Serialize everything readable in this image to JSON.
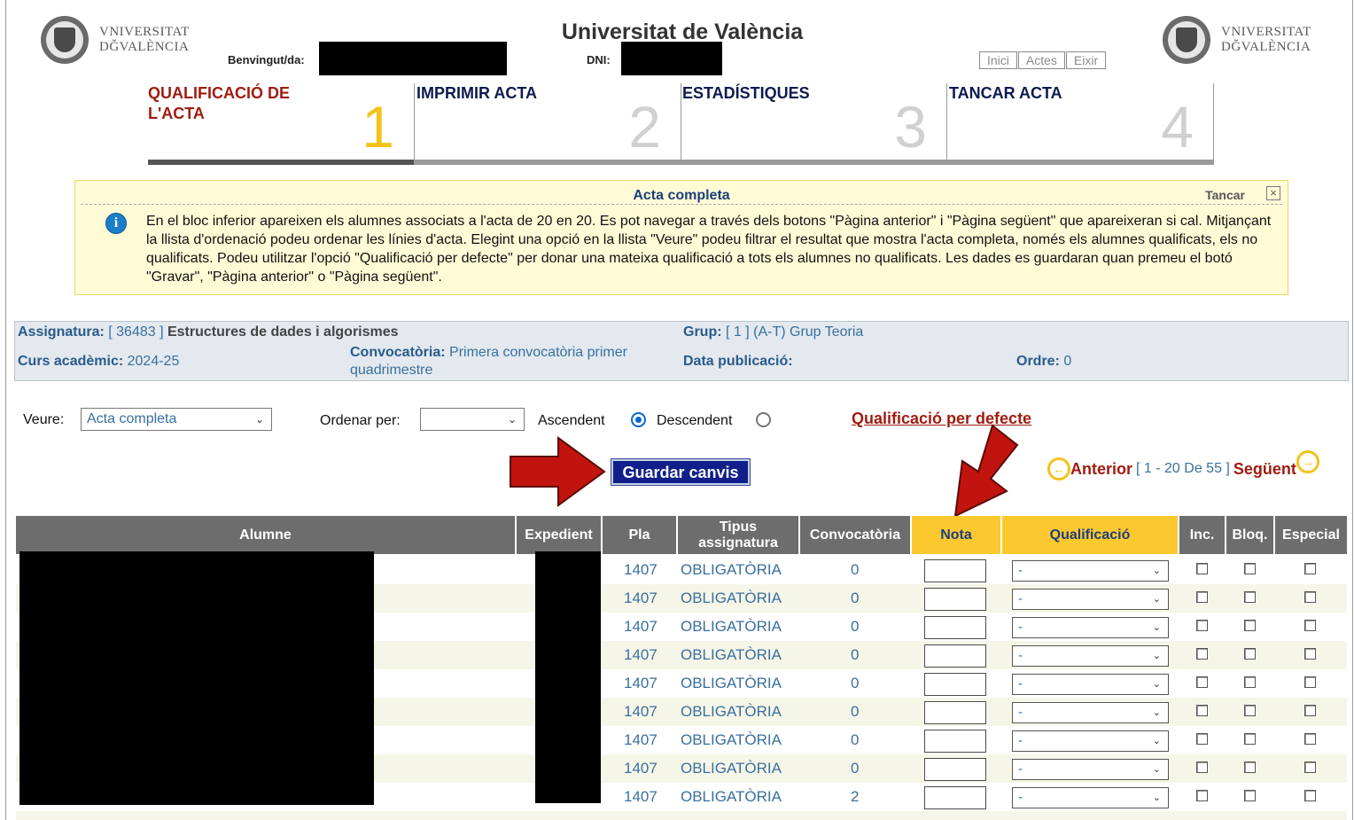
{
  "header": {
    "logo_line1": "VNIVERSITAT",
    "logo_line2": "DĞVALÈNCIA",
    "title": "Universitat de València",
    "welcome_label": "Benvingut/da:",
    "dni_label": "DNI:",
    "nav": [
      "Inici",
      "Actes",
      "Eixir"
    ]
  },
  "steps": [
    {
      "label": "QUALIFICACIÓ DE L'ACTA",
      "number": "1",
      "active": true
    },
    {
      "label": "IMPRIMIR ACTA",
      "number": "2",
      "active": false
    },
    {
      "label": "ESTADÍSTIQUES",
      "number": "3",
      "active": false
    },
    {
      "label": "TANCAR ACTA",
      "number": "4",
      "active": false
    }
  ],
  "info": {
    "title": "Acta completa",
    "close_label": "Tancar",
    "close_icon": "close-icon",
    "text": "En el bloc inferior apareixen els alumnes associats a l'acta de 20 en 20. Es pot navegar a través dels botons \"Pàgina anterior\" i \"Pàgina següent\" que apareixeran si cal. Mitjançant la llista d'ordenació podeu ordenar les línies d'acta. Elegint una opció en la llista \"Veure\" podeu filtrar el resultat que mostra l'acta completa, només els alumnes qualificats, els no qualificats. Podeu utilitzar l'opció \"Qualificació per defecte\" per donar una mateixa qualificació a tots els alumnes no qualificats. Les dades es guardaran quan premeu el botó \"Gravar\", \"Pàgina anterior\" o \"Pàgina següent\"."
  },
  "subject": {
    "assignatura_label": "Assignatura:",
    "assignatura_code": "[ 36483 ]",
    "assignatura_name": "Estructures de dades i algorismes",
    "grup_label": "Grup:",
    "grup_value": "[ 1 ] (A-T) Grup Teoria",
    "curs_label": "Curs acadèmic:",
    "curs_value": "2024-25",
    "convocatoria_label": "Convocatòria:",
    "convocatoria_value": "Primera convocatòria primer quadrimestre",
    "data_label": "Data publicació:",
    "data_value": "",
    "ordre_label": "Ordre:",
    "ordre_value": "0"
  },
  "controls": {
    "veure_label": "Veure:",
    "veure_value": "Acta completa",
    "ordenar_label": "Ordenar per:",
    "ordenar_value": "",
    "ascendent_label": "Ascendent",
    "descendent_label": "Descendent",
    "selected_order": "Ascendent",
    "default_grade_link": "Qualificació per defecte",
    "save_button": "Guardar canvis"
  },
  "pager": {
    "prev": "Anterior",
    "range": "[ 1 - 20 De 55 ]",
    "next": "Següent"
  },
  "table": {
    "headers": [
      "Alumne",
      "Expedient",
      "Pla",
      "Tipus assignatura",
      "Convocatòria",
      "Nota",
      "Qualificació",
      "Inc.",
      "Bloq.",
      "Especial"
    ],
    "rows": [
      {
        "pla": "1407",
        "tipus": "OBLIGATÒRIA",
        "convocatoria": "0",
        "qualificacio": "-"
      },
      {
        "pla": "1407",
        "tipus": "OBLIGATÒRIA",
        "convocatoria": "0",
        "qualificacio": "-"
      },
      {
        "pla": "1407",
        "tipus": "OBLIGATÒRIA",
        "convocatoria": "0",
        "qualificacio": "-"
      },
      {
        "pla": "1407",
        "tipus": "OBLIGATÒRIA",
        "convocatoria": "0",
        "qualificacio": "-"
      },
      {
        "pla": "1407",
        "tipus": "OBLIGATÒRIA",
        "convocatoria": "0",
        "qualificacio": "-"
      },
      {
        "pla": "1407",
        "tipus": "OBLIGATÒRIA",
        "convocatoria": "0",
        "qualificacio": "-"
      },
      {
        "pla": "1407",
        "tipus": "OBLIGATÒRIA",
        "convocatoria": "0",
        "qualificacio": "-"
      },
      {
        "pla": "1407",
        "tipus": "OBLIGATÒRIA",
        "convocatoria": "0",
        "qualificacio": "-"
      },
      {
        "pla": "1407",
        "tipus": "OBLIGATÒRIA",
        "convocatoria": "2",
        "qualificacio": "-"
      }
    ]
  },
  "colors": {
    "accent_red": "#a01c10",
    "accent_yellow": "#fbc830",
    "link_blue": "#3a6f9e",
    "header_gray": "#6d6d6d",
    "save_button_bg": "#101f8a"
  }
}
